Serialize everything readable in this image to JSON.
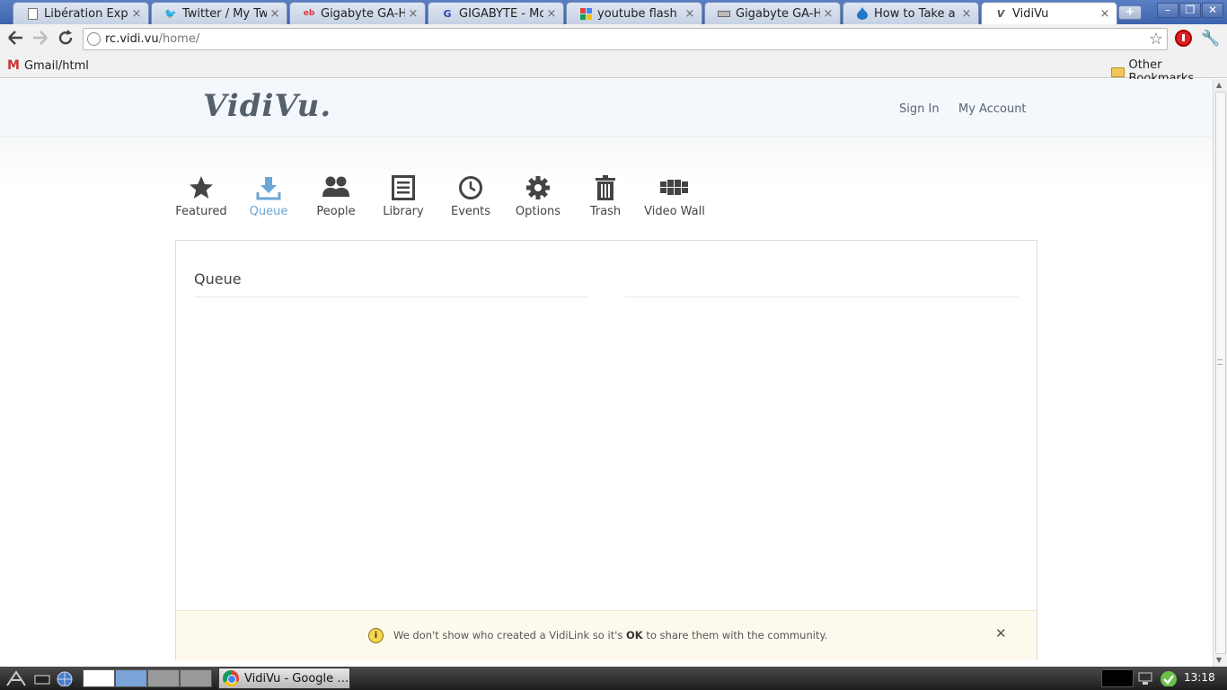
{
  "browser": {
    "tabs": [
      {
        "title": "Libération Exp…",
        "favicon": "page-icon"
      },
      {
        "title": "Twitter / My Tw…",
        "favicon": "twitter-icon"
      },
      {
        "title": "Gigabyte GA-H…",
        "favicon": "ebay-icon"
      },
      {
        "title": "GIGABYTE - Mo…",
        "favicon": "gigabyte-icon"
      },
      {
        "title": "youtube flash …",
        "favicon": "google-icon"
      },
      {
        "title": "Gigabyte GA-H…",
        "favicon": "drive-icon"
      },
      {
        "title": "How to Take a …",
        "favicon": "drupal-icon"
      },
      {
        "title": "VidiVu",
        "favicon": "vidivu-icon",
        "active": true
      }
    ],
    "close_glyph": "×",
    "url_host": "rc.vidi.vu",
    "url_path": "/home/",
    "bookmarks": {
      "left": "Gmail/html",
      "right": "Other Bookmarks"
    }
  },
  "site": {
    "logo": "VidiVu.",
    "header_links": {
      "sign_in": "Sign In",
      "my_account": "My Account"
    },
    "nav": [
      {
        "label": "Featured",
        "icon": "star-icon"
      },
      {
        "label": "Queue",
        "icon": "download-icon",
        "active": true
      },
      {
        "label": "People",
        "icon": "people-icon"
      },
      {
        "label": "Library",
        "icon": "library-icon"
      },
      {
        "label": "Events",
        "icon": "clock-icon"
      },
      {
        "label": "Options",
        "icon": "gear-icon"
      },
      {
        "label": "Trash",
        "icon": "trash-icon"
      },
      {
        "label": "Video Wall",
        "icon": "video-wall-icon"
      }
    ],
    "panel_title": "Queue",
    "notice": {
      "before": "We don't show who created a VidiLink so it's ",
      "bold": "OK",
      "after": " to share them with the community."
    }
  },
  "taskbar": {
    "task_label": "VidiVu - Google …",
    "clock": "13:18"
  },
  "colors": {
    "accent": "#6ba6d6",
    "notice_bg": "#fdfaed",
    "header_bg": "#f4f8fc"
  }
}
